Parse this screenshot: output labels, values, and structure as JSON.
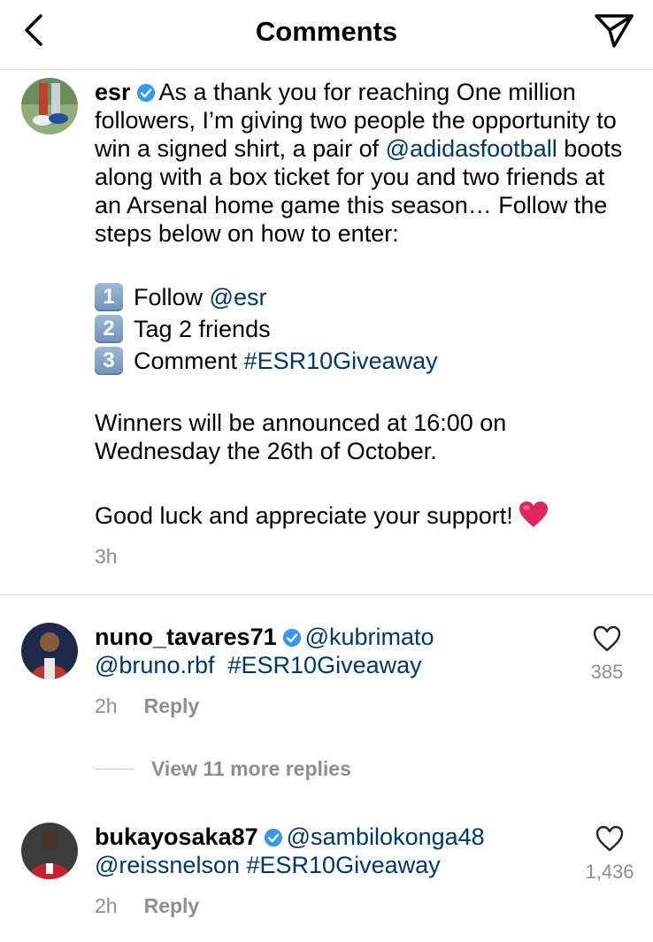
{
  "header": {
    "title": "Comments"
  },
  "caption": {
    "username": "esr",
    "lines": [
      "As a thank you for reaching One million followers, I’m giving two people the opportunity to win a signed shirt, a pair of ",
      "@adidasfootball",
      " boots along with a box ticket for you and two friends at an Arsenal home game this season… Follow the steps below on how to enter:"
    ],
    "steps": [
      {
        "num": "1",
        "text": "Follow ",
        "link": "@esr"
      },
      {
        "num": "2",
        "text": "Tag 2 friends",
        "link": ""
      },
      {
        "num": "3",
        "text": "Comment ",
        "link": "#ESR10Giveaway"
      }
    ],
    "winners": "Winners will be announced at 16:00 on Wednesday the 26th of October.",
    "closing": "Good luck and appreciate your support!",
    "time": "3h"
  },
  "comments": [
    {
      "username": "nuno_tavares71",
      "mention1": "@kubrimato",
      "mention2": "@bruno.rbf",
      "hashtag": "#ESR10Giveaway",
      "time": "2h",
      "reply": "Reply",
      "likes": "385",
      "view_replies": "View 11 more replies"
    },
    {
      "username": "bukayosaka87",
      "mention1": "@sambilokonga48",
      "mention2": "@reissnelson",
      "hashtag": "#ESR10Giveaway",
      "time": "2h",
      "reply": "Reply",
      "likes": "1,436"
    }
  ],
  "colors": {
    "link": "#00376b",
    "muted": "#8e8e8e",
    "verified": "#3897f0",
    "heart": "#e0245e"
  },
  "icons": {
    "back": "chevron-left-icon",
    "send": "paper-plane-icon",
    "verified": "verified-badge-icon",
    "like": "heart-outline-icon",
    "emoji": "red-heart-emoji"
  }
}
